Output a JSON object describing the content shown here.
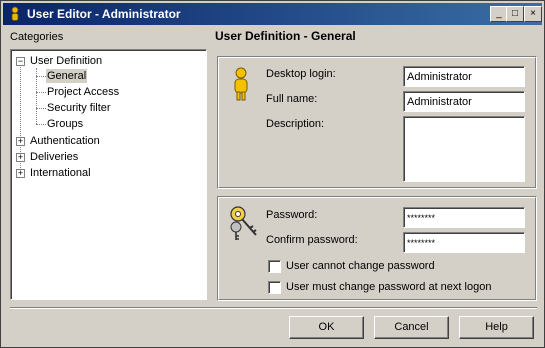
{
  "window": {
    "title": "User Editor - Administrator"
  },
  "titlebar_buttons": {
    "minimize": "_",
    "maximize": "□",
    "close": "×"
  },
  "sidebar": {
    "label": "Categories",
    "tree": [
      {
        "label": "User Definition",
        "expanded": true,
        "children": [
          "General",
          "Project Access",
          "Security filter",
          "Groups"
        ]
      },
      {
        "label": "Authentication",
        "expanded": false
      },
      {
        "label": "Deliveries",
        "expanded": false
      },
      {
        "label": "International",
        "expanded": false
      }
    ],
    "selected": "General"
  },
  "main": {
    "title": "User Definition - General",
    "identity": {
      "desktop_login_label": "Desktop login:",
      "desktop_login_value": "Administrator",
      "full_name_label": "Full name:",
      "full_name_value": "Administrator",
      "description_label": "Description:",
      "description_value": ""
    },
    "password": {
      "password_label": "Password:",
      "password_value": "********",
      "confirm_label": "Confirm password:",
      "confirm_value": "********",
      "cannot_change_label": "User cannot change password",
      "cannot_change_checked": false,
      "must_change_label": "User must change password at next logon",
      "must_change_checked": false
    }
  },
  "footer": {
    "ok_label": "OK",
    "cancel_label": "Cancel",
    "help_label": "Help"
  }
}
